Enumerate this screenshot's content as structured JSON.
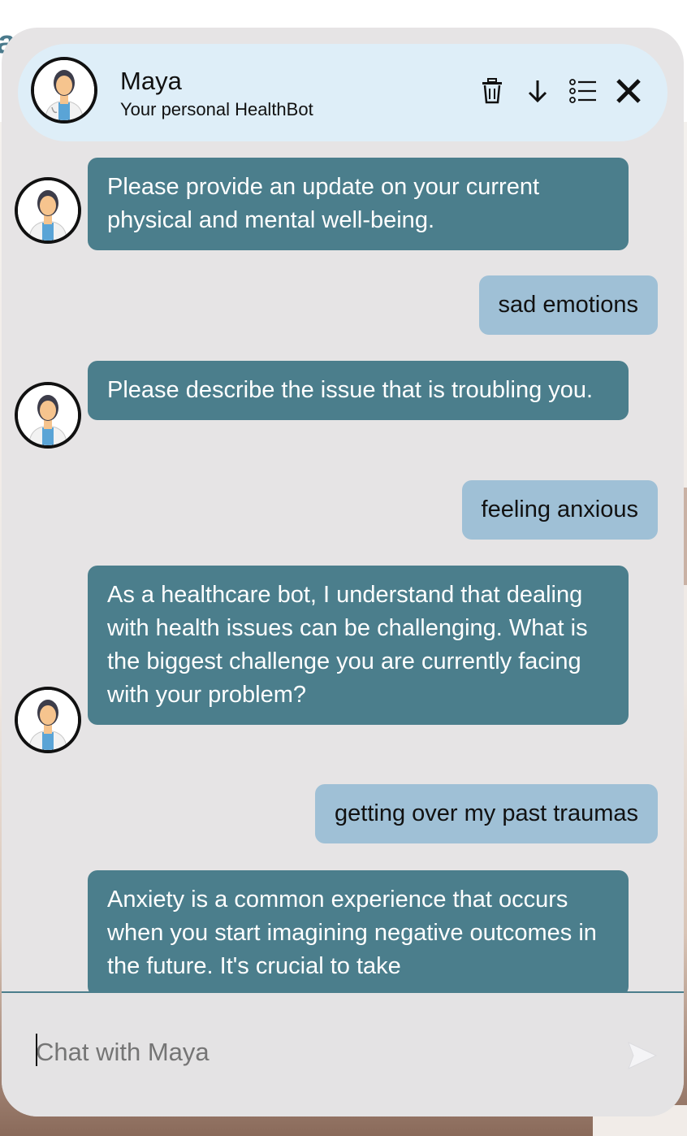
{
  "header": {
    "bot_name": "Maya",
    "subtitle": "Your personal HealthBot",
    "icons": [
      "trash-icon",
      "arrow-down-icon",
      "list-icon",
      "close-icon"
    ]
  },
  "messages": [
    {
      "from": "bot",
      "text": "Please provide an update on your current physical and mental well-being."
    },
    {
      "from": "user",
      "text": "sad emotions"
    },
    {
      "from": "bot",
      "text": "Please describe the issue that is troubling you."
    },
    {
      "from": "user",
      "text": "feeling anxious"
    },
    {
      "from": "bot",
      "text": "As a healthcare bot, I understand that dealing with health issues can be challenging. What is the biggest challenge you are currently facing with your problem?"
    },
    {
      "from": "user",
      "text": "getting over my past traumas"
    },
    {
      "from": "bot",
      "text": "Anxiety is a common experience that occurs when you start imagining negative outcomes in the future. It's crucial to take"
    }
  ],
  "composer": {
    "placeholder": "Chat with Maya"
  },
  "colors": {
    "bot_bubble": "#4b7e8c",
    "user_bubble": "#9fc0d6",
    "header_bg": "#deeef8",
    "panel_bg": "#e6e4e5"
  }
}
